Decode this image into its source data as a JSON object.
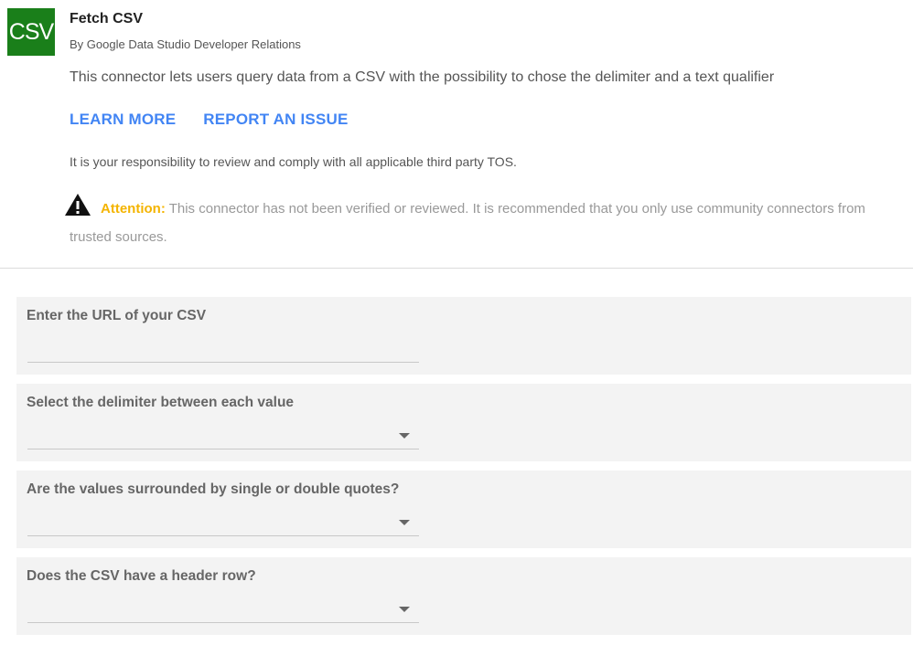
{
  "connector": {
    "logo_text": "CSV",
    "title": "Fetch CSV",
    "author": "By Google Data Studio Developer Relations",
    "description": "This connector lets users query data from a CSV with the possibility to chose the delimiter and a text qualifier",
    "links": {
      "learn_more": "LEARN MORE",
      "report_issue": "REPORT AN ISSUE"
    },
    "tos": "It is your responsibility to review and comply with all applicable third party TOS.",
    "attention_label": "Attention:",
    "attention_text": "This connector has not been verified or reviewed. It is recommended that you only use community connectors from trusted sources."
  },
  "form": {
    "fields": [
      {
        "label": "Enter the URL of your CSV",
        "type": "text",
        "value": ""
      },
      {
        "label": "Select the delimiter between each value",
        "type": "select",
        "value": ""
      },
      {
        "label": "Are the values surrounded by single or double quotes?",
        "type": "select",
        "value": ""
      },
      {
        "label": "Does the CSV have a header row?",
        "type": "select",
        "value": ""
      }
    ]
  },
  "colors": {
    "link": "#4285f4",
    "logo_bg": "#1a7f1a",
    "attention": "#f4b400",
    "field_bg": "#f3f3f3"
  },
  "icons": {
    "warning": "warning-triangle-icon",
    "dropdown": "chevron-down-icon"
  }
}
